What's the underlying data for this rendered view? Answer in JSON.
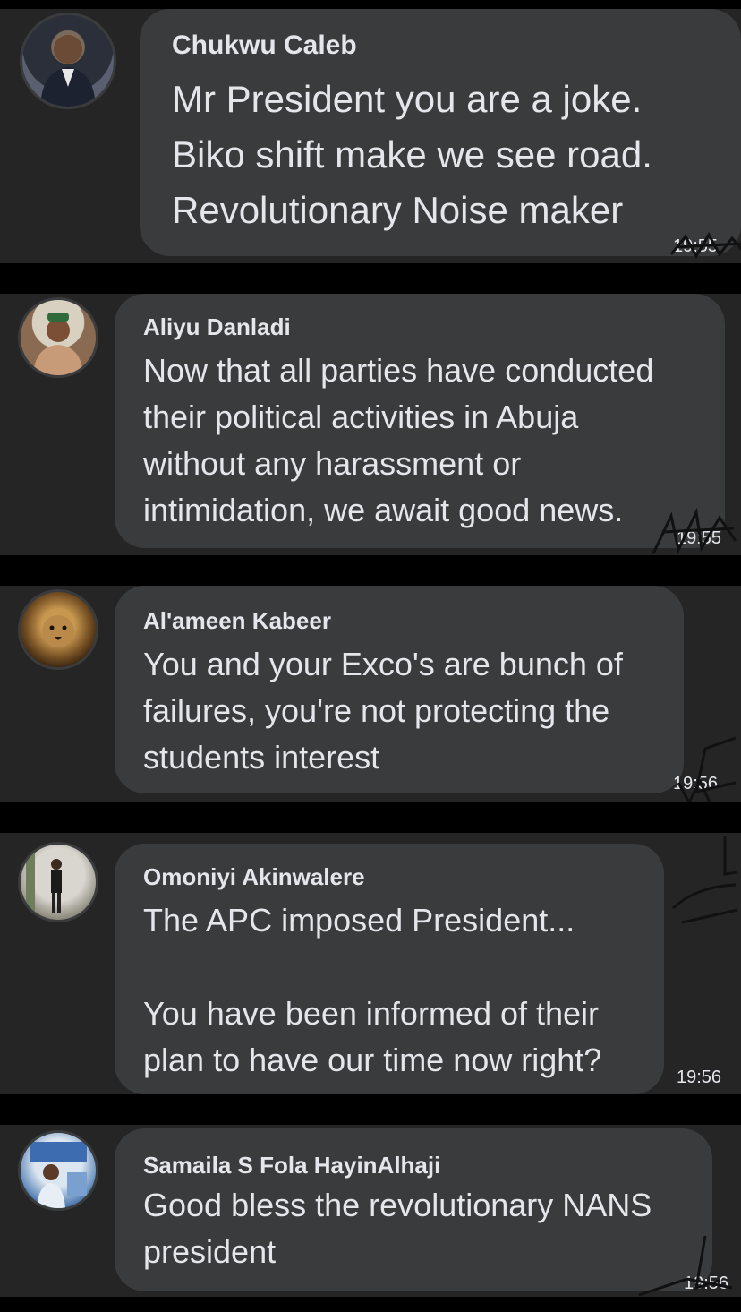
{
  "comments": [
    {
      "author": "Chukwu Caleb",
      "text": "Mr President you are a joke.\nBiko shift make we see road.\nRevolutionary Noise maker",
      "time": "19:55"
    },
    {
      "author": "Aliyu Danladi",
      "text": "Now that all parties have conducted\ntheir political activities in Abuja\nwithout any harassment or\nintimidation, we await good news.",
      "time": "19:55"
    },
    {
      "author": "Al'ameen Kabeer",
      "text": "You and your Exco's are bunch of\nfailures, you're not protecting the\nstudents interest",
      "time": "19:56"
    },
    {
      "author": "Omoniyi Akinwalere",
      "text": "The APC imposed President...\n\nYou have been informed of their\nplan to have our time now right?",
      "time": "19:56"
    },
    {
      "author": "Samaila S Fola HayinAlhaji",
      "text": "Good bless the revolutionary NANS\npresident",
      "time": "19:56"
    }
  ],
  "colors": {
    "background": "#000000",
    "panel": "#252526",
    "bubble": "#3a3b3c",
    "text": "#e4e6eb"
  }
}
